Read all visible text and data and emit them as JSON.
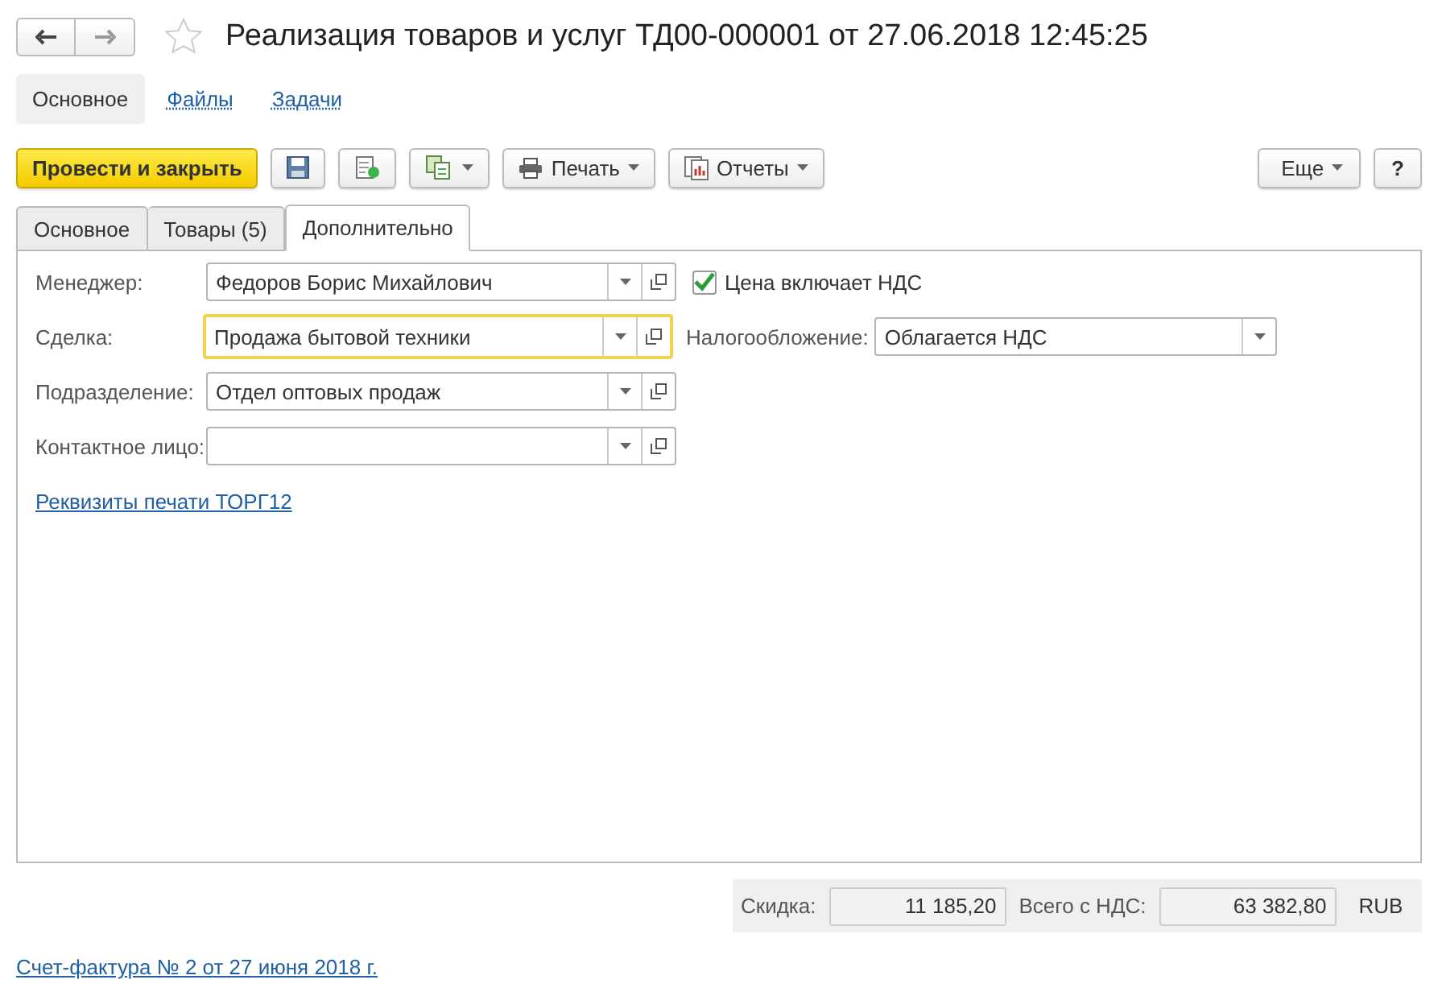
{
  "window": {
    "title": "Реализация товаров и услуг ТД00-000001 от 27.06.2018 12:45:25"
  },
  "sections": [
    {
      "label": "Основное",
      "selected": true
    },
    {
      "label": "Файлы",
      "selected": false
    },
    {
      "label": "Задачи",
      "selected": false
    }
  ],
  "toolbar": [
    {
      "kind": "primary",
      "label": "Провести и закрыть"
    },
    {
      "kind": "save"
    },
    {
      "kind": "post"
    },
    {
      "kind": "related"
    },
    {
      "kind": "print",
      "label": "Печать"
    },
    {
      "kind": "reports",
      "label": "Отчеты"
    }
  ],
  "toolbar_right": [
    {
      "kind": "menu",
      "label": "Еще"
    },
    {
      "kind": "plain",
      "label": "?"
    }
  ],
  "tabs": [
    {
      "label": "Основное",
      "selected": false
    },
    {
      "label": "Товары (5)",
      "selected": false
    },
    {
      "label": "Дополнительно",
      "selected": true
    }
  ],
  "fields": [
    {
      "label": "Менеджер:",
      "value": "Федоров Борис Михайлович",
      "focused": false
    },
    {
      "label": "Сделка:",
      "value": "Продажа бытовой техники",
      "focused": true
    },
    {
      "label": "Подразделение:",
      "value": "Отдел оптовых продаж",
      "focused": false
    },
    {
      "label": "Контактное лицо:",
      "focused": false
    }
  ],
  "price_includes_vat": {
    "label": "Цена включает НДС",
    "checked": true
  },
  "taxation": {
    "label": "Налогообложение:",
    "value": "Облагается НДС"
  },
  "print_link": "Реквизиты печати ТОРГ12",
  "totals": {
    "discount_label": "Скидка:",
    "discount": "11 185,20",
    "total_label": "Всего с НДС:",
    "total": "63 382,80",
    "currency": "RUB"
  },
  "invoice_link": "Счет-фактура № 2 от 27 июня 2018 г."
}
